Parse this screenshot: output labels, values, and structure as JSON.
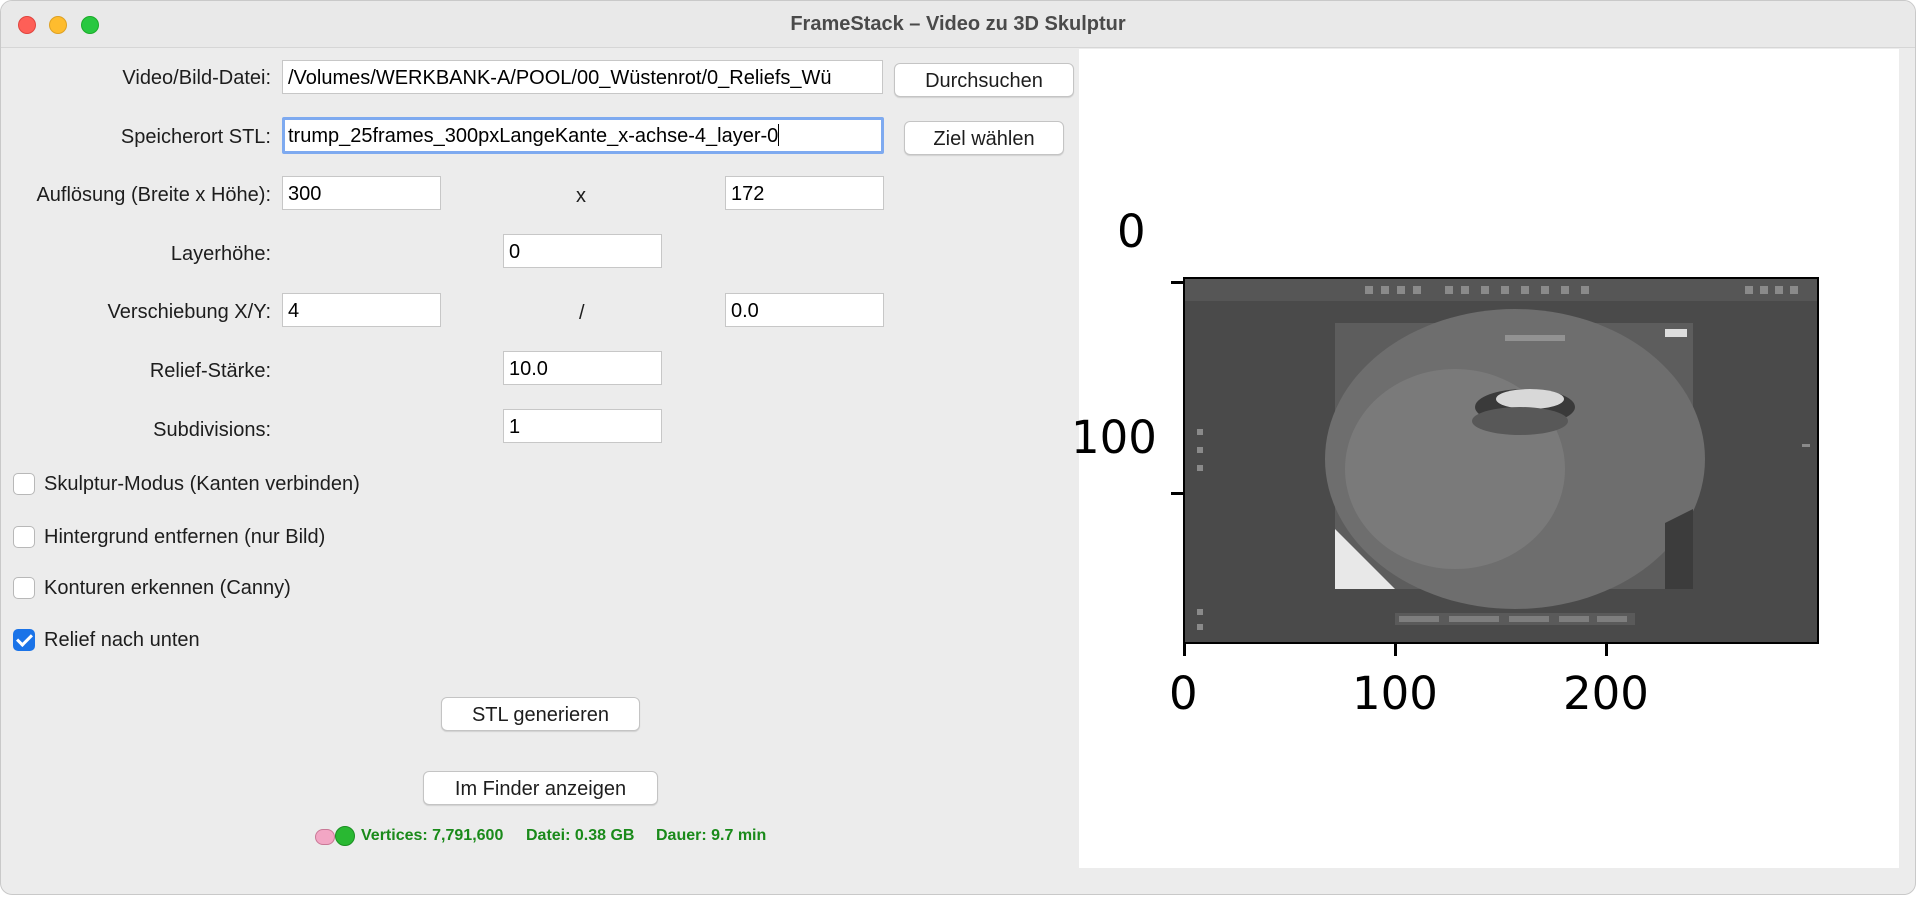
{
  "window": {
    "title": "FrameStack – Video zu 3D Skulptur"
  },
  "form": {
    "video_label": "Video/Bild-Datei:",
    "video_value": "/Volumes/WERKBANK-A/POOL/00_Wüstenrot/0_Reliefs_Wü",
    "browse_button": "Durchsuchen",
    "stl_label": "Speicherort STL:",
    "stl_value": "trump_25frames_300pxLangeKante_x-achse-4_layer-0",
    "target_button": "Ziel wählen",
    "resolution_label": "Auflösung (Breite x Höhe):",
    "res_width": "300",
    "res_sep": "x",
    "res_height": "172",
    "layer_label": "Layerhöhe:",
    "layer_value": "0",
    "shift_label": "Verschiebung X/Y:",
    "shift_x": "4",
    "shift_sep": "/",
    "shift_y": "0.0",
    "relief_label": "Relief-Stärke:",
    "relief_value": "10.0",
    "subdiv_label": "Subdivisions:",
    "subdiv_value": "1"
  },
  "options": [
    {
      "label": "Skulptur-Modus (Kanten verbinden)",
      "checked": false
    },
    {
      "label": "Hintergrund entfernen (nur Bild)",
      "checked": false
    },
    {
      "label": "Konturen erkennen (Canny)",
      "checked": false
    },
    {
      "label": "Relief nach unten",
      "checked": true
    }
  ],
  "actions": {
    "generate_button": "STL generieren",
    "finder_button": "Im Finder anzeigen"
  },
  "status": {
    "vertices": "Vertices: 7,791,600",
    "file": "Datei: 0.38 GB",
    "duration": "Dauer: 9.7 min",
    "color": "#1a8a1a"
  },
  "preview": {
    "y_ticks": [
      "0",
      "100"
    ],
    "x_ticks": [
      "0",
      "100",
      "200"
    ],
    "y_tick_partial": "100"
  },
  "colors": {
    "accent": "#1a73e8",
    "focus_ring": "#7eaaf0"
  }
}
